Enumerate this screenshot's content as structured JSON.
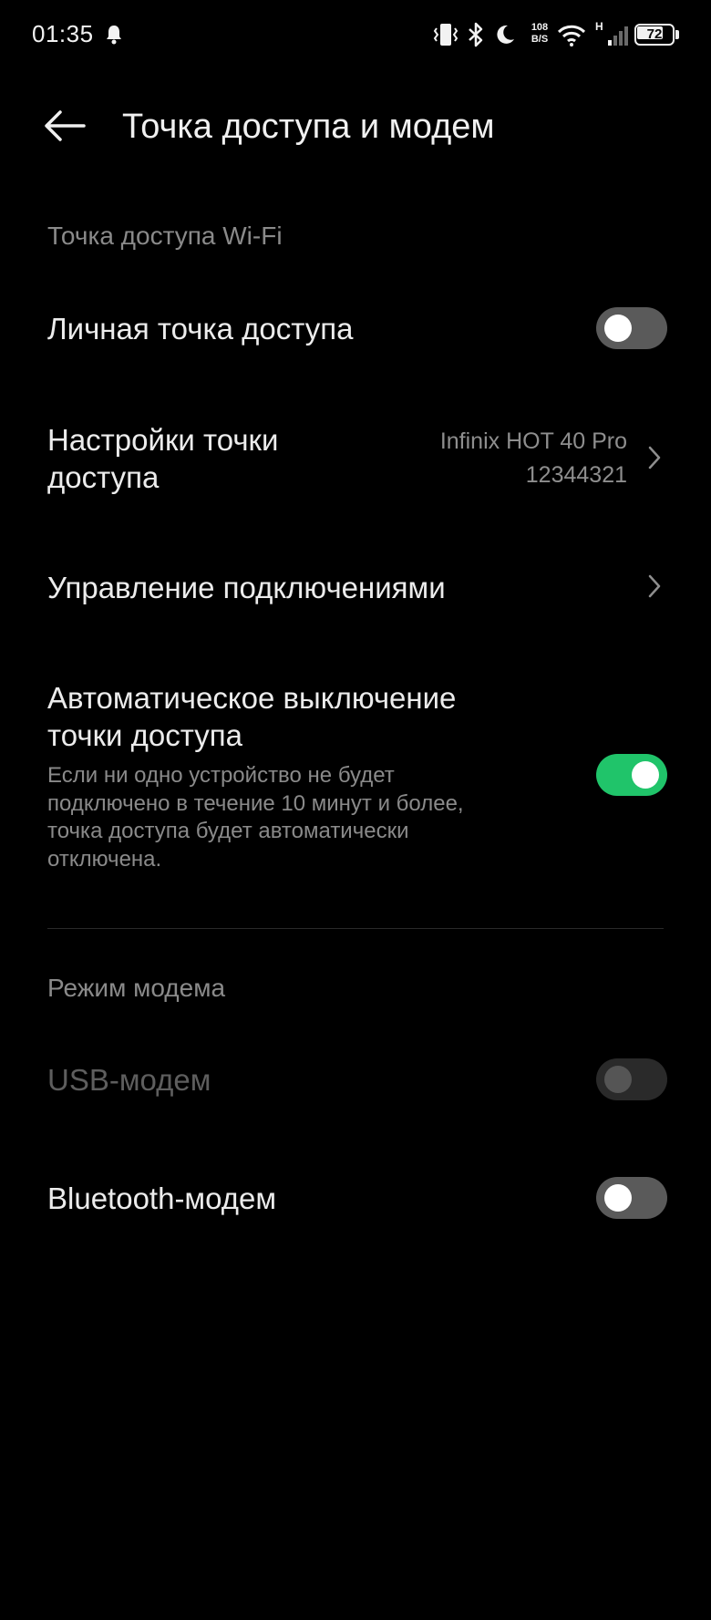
{
  "status_bar": {
    "time": "01:35",
    "net_speed_value": "108",
    "net_speed_unit": "B/S",
    "network_type": "H",
    "battery": "72",
    "icons": [
      "notification-bell-icon",
      "vibrate-icon",
      "bluetooth-icon",
      "do-not-disturb-moon-icon",
      "wifi-icon",
      "signal-icon",
      "battery-icon"
    ]
  },
  "header": {
    "title": "Точка доступа и модем",
    "back_icon": "back-arrow-icon"
  },
  "wifi_hotspot_section": {
    "title": "Точка доступа Wi-Fi",
    "personal_hotspot": {
      "label": "Личная точка доступа",
      "enabled": false
    },
    "hotspot_settings": {
      "label_line1": "Настройки точки",
      "label_line2": "доступа",
      "value_line1": "Infinix HOT 40 Pro",
      "value_line2": "12344321"
    },
    "connection_management": {
      "label": "Управление подключениями"
    },
    "auto_off": {
      "label_line1": "Автоматическое выключение",
      "label_line2": "точки доступа",
      "desc_line1": "Если ни одно устройство не будет",
      "desc_line2": "подключено в течение 10 минут и более,",
      "desc_line3": "точка доступа будет автоматически",
      "desc_line4": "отключена.",
      "enabled": true
    }
  },
  "modem_section": {
    "title": "Режим модема",
    "usb_modem": {
      "label": "USB-модем",
      "enabled": false,
      "disabled": true
    },
    "bluetooth_modem": {
      "label": "Bluetooth-модем",
      "enabled": false
    }
  },
  "colors": {
    "background": "#000000",
    "accent_green": "#20c46a",
    "secondary_text": "#8a8a8a",
    "toggle_off": "#5a5a5a"
  }
}
